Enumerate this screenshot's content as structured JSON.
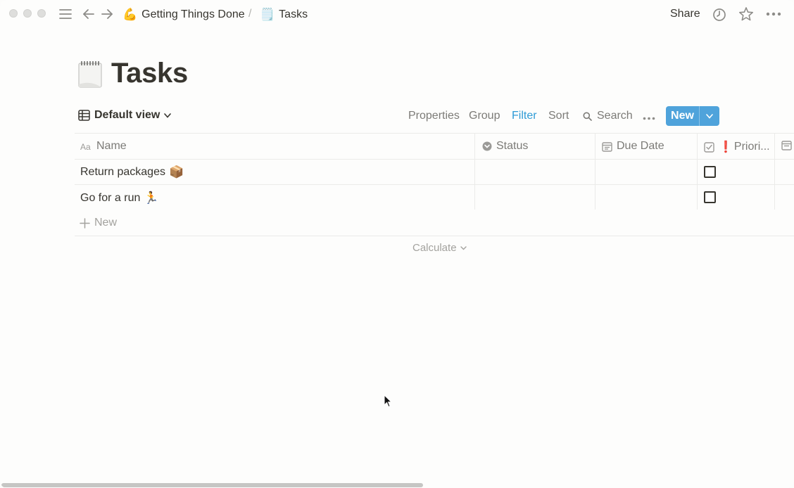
{
  "window": {
    "breadcrumbs": [
      {
        "emoji": "💪",
        "label": "Getting Things Done"
      },
      {
        "emoji": "🗒️",
        "label": "Tasks"
      }
    ],
    "breadcrumb_separator": "/",
    "share_label": "Share",
    "icons": {
      "menu": "hamburger-menu-icon",
      "back": "arrow-left-icon",
      "forward": "arrow-right-icon",
      "history": "clock-icon",
      "favorite": "star-icon",
      "more": "more-horizontal-icon"
    }
  },
  "page": {
    "title": "Tasks",
    "title_icon": "notepad-icon"
  },
  "toolbar": {
    "view_name": "Default view",
    "properties": "Properties",
    "group": "Group",
    "filter": "Filter",
    "sort": "Sort",
    "search": "Search",
    "new": "New"
  },
  "table": {
    "columns": [
      {
        "label": "Name",
        "icon": "text-aa-icon"
      },
      {
        "label": "Status",
        "icon": "status-icon"
      },
      {
        "label": "Due Date",
        "icon": "calendar-icon"
      },
      {
        "label": "Priori...",
        "icon": "checkbox-icon",
        "prefix": "❗"
      }
    ],
    "rows": [
      {
        "name": "Return packages",
        "emoji": "📦",
        "status": "",
        "due_date": "",
        "priority": false
      },
      {
        "name": "Go for a run",
        "emoji": "🏃",
        "status": "",
        "due_date": "",
        "priority": false
      }
    ],
    "add_row_label": "New",
    "calculate_label": "Calculate"
  },
  "colors": {
    "accent": "#2e9bd6",
    "new_button": "#4fa3db",
    "text": "#37352f",
    "muted": "#7c7b77"
  }
}
